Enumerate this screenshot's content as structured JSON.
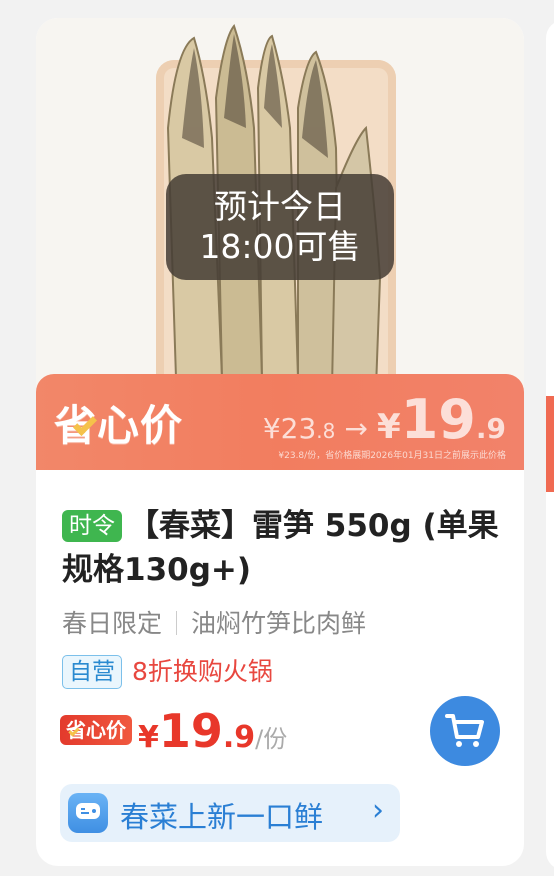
{
  "product": {
    "preorder_line1": "预计今日",
    "preorder_line2": "18:00可售",
    "banner_logo": "省心价",
    "banner_old_price_int": "¥23",
    "banner_old_price_dec": ".8",
    "banner_arrow": "→",
    "banner_new_yen": "¥",
    "banner_new_int": "19",
    "banner_new_dec": ".9",
    "banner_note": "¥23.8/份，省价格展期2026年01月31日之前展示此价格",
    "tag_seasonal": "时令",
    "title": "【春菜】雷笋 550g (单果规格130g+)",
    "subtitle_left": "春日限定",
    "subtitle_right": "油焖竹笋比肉鲜",
    "tag_self": "自营",
    "promo": "8折换购火锅",
    "price_badge": "省心价",
    "price_yen": "¥",
    "price_int": "19",
    "price_dec": ".9",
    "price_unit": "/份",
    "pill_text": "春菜上新一口鲜",
    "pill_arrow": "›"
  },
  "colors": {
    "banner": "#f27d5f",
    "price_red": "#e8372a",
    "seasonal_green": "#3fb64f",
    "cart_blue": "#3d8ae0",
    "pill_blue": "#2a7fd4"
  },
  "icons": {
    "cart": "cart-icon",
    "pill": "chat-bubble-icon",
    "arrow": "chevron-right-icon"
  }
}
